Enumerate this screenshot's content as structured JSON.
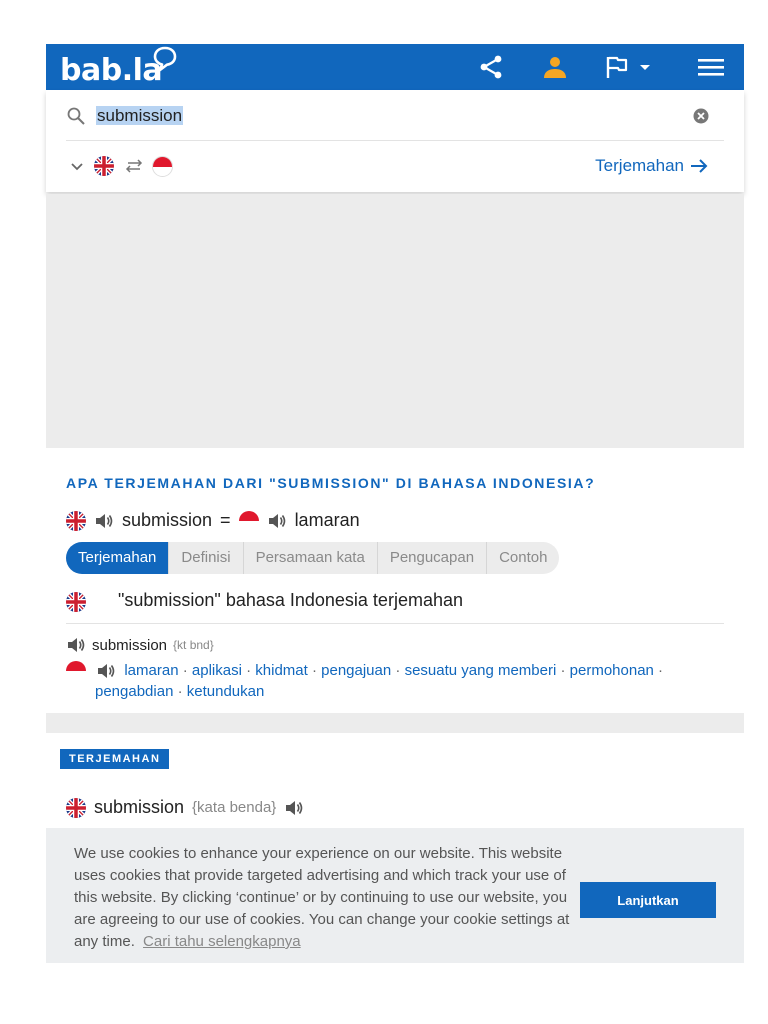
{
  "header": {
    "logo_text": "bab.la",
    "brand_color": "#1167bd",
    "accent_user": "#f5a623",
    "icons": [
      "share-icon",
      "user-icon",
      "flag-icon",
      "menu-icon"
    ]
  },
  "search": {
    "query": "submission",
    "translate_label": "Terjemahan"
  },
  "languages": {
    "source": "english-flag",
    "target": "indonesia-flag"
  },
  "section": {
    "question": "APA TERJEMAHAN DARI \"SUBMISSION\" DI BAHASA INDONESIA?",
    "source_word": "submission",
    "equals": "=",
    "target_word": "lamaran"
  },
  "tabs": [
    {
      "label": "Terjemahan",
      "active": true
    },
    {
      "label": "Definisi",
      "active": false
    },
    {
      "label": "Persamaan kata",
      "active": false
    },
    {
      "label": "Pengucapan",
      "active": false
    },
    {
      "label": "Contoh",
      "active": false
    }
  ],
  "translation_heading": "\"submission\" bahasa Indonesia terjemahan",
  "entry": {
    "word": "submission",
    "grammar": "{kt bnd}",
    "translations": [
      "lamaran",
      "aplikasi",
      "khidmat",
      "pengajuan",
      "sesuatu yang memberi",
      "permohonan",
      "pengabdian",
      "ketundukan"
    ]
  },
  "section2": {
    "badge": "TERJEMAHAN",
    "word": "submission",
    "grammar": "{kata benda}"
  },
  "cookie": {
    "text": "We use cookies to enhance your experience on our website. This website uses cookies that provide targeted advertising and which track your use of this website. By clicking ‘continue’ or by continuing to use our website, you are agreeing to our use of cookies. You can change your cookie settings at any time.",
    "link_label": "Cari tahu selengkapnya",
    "button_label": "Lanjutkan"
  }
}
